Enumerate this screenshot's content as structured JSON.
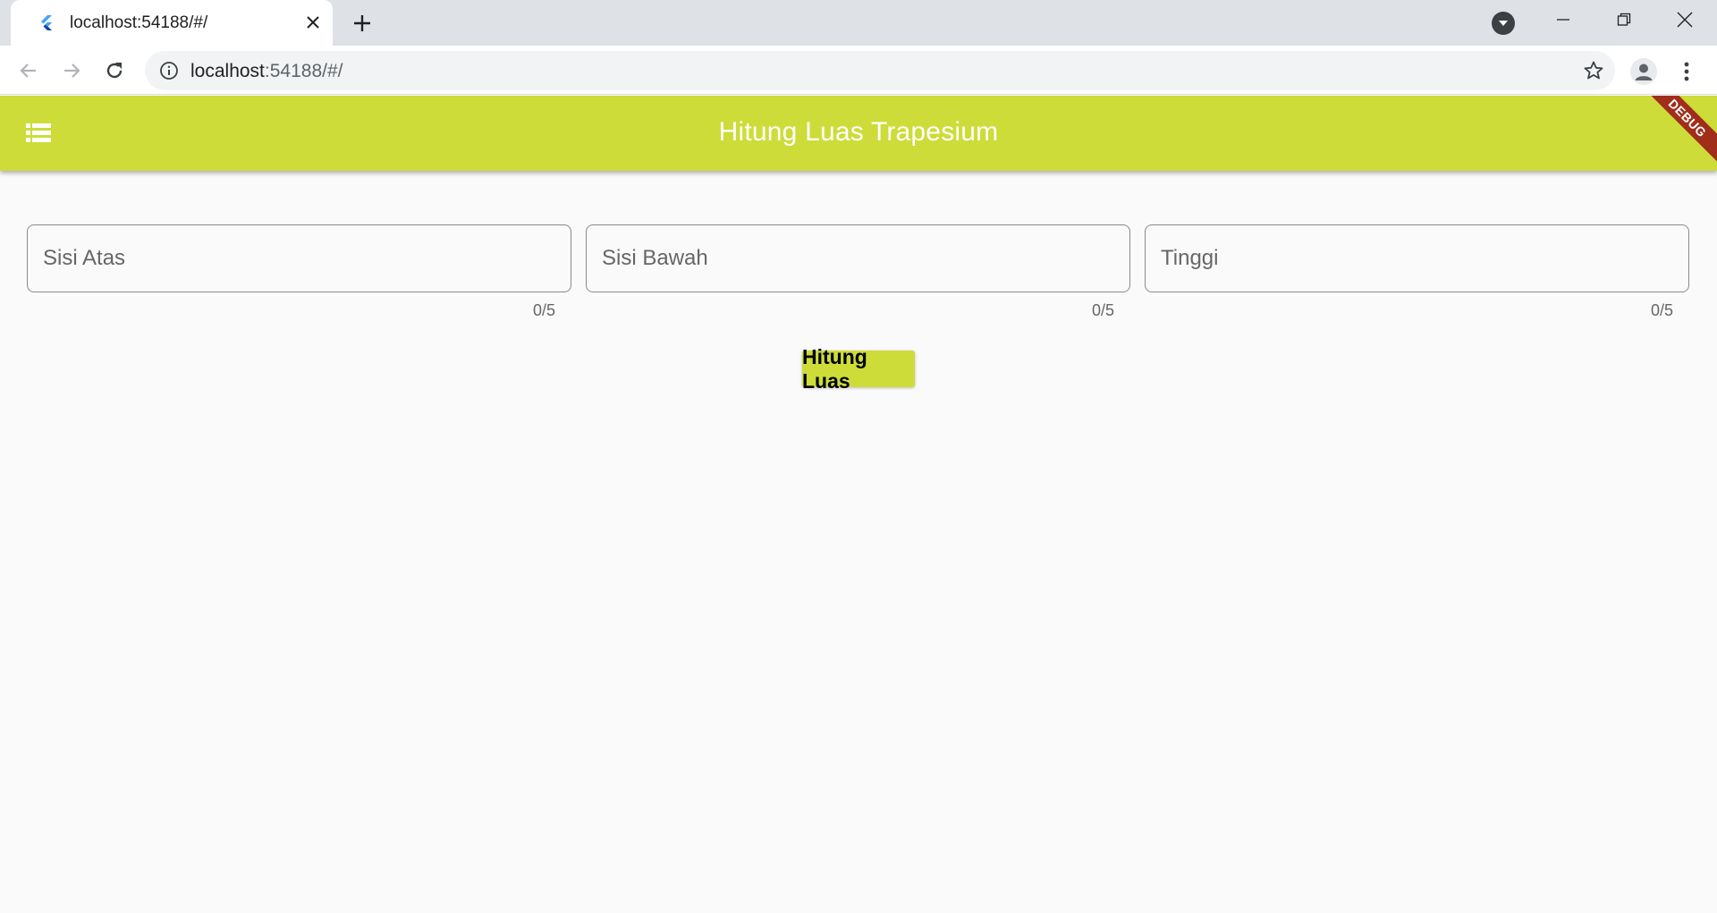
{
  "browser": {
    "tab": {
      "title": "localhost:54188/#/"
    },
    "omnibox": {
      "host": "localhost",
      "rest": ":54188/#/"
    }
  },
  "app": {
    "title": "Hitung Luas Trapesium",
    "debug_banner": "DEBUG",
    "accent_color": "#cddc39",
    "fields": [
      {
        "placeholder": "Sisi Atas",
        "value": "",
        "counter": "0/5"
      },
      {
        "placeholder": "Sisi Bawah",
        "value": "",
        "counter": "0/5"
      },
      {
        "placeholder": "Tinggi",
        "value": "",
        "counter": "0/5"
      }
    ],
    "button_label": "Hitung Luas"
  }
}
